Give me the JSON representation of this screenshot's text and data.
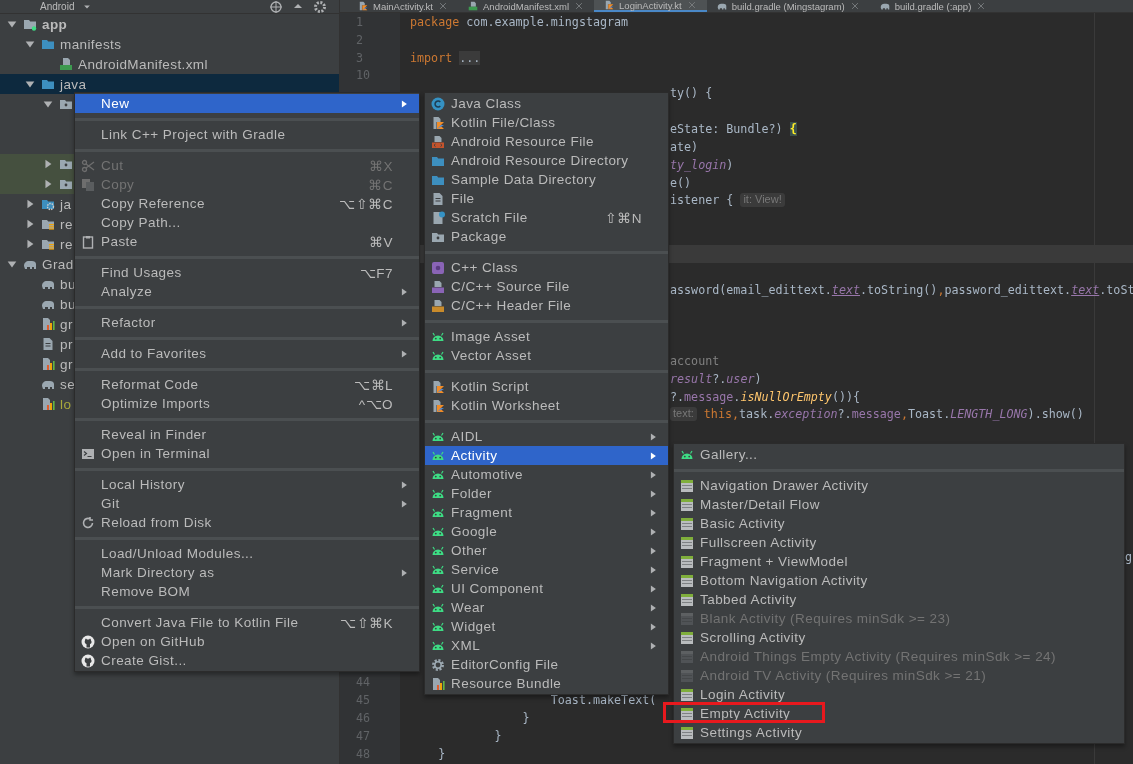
{
  "tabs": [
    {
      "label": "MainActivity.kt",
      "kind": "kotlin",
      "selected": false
    },
    {
      "label": "AndroidManifest.xml",
      "kind": "manifest",
      "selected": false
    },
    {
      "label": "LoginActivity.kt",
      "kind": "kotlin",
      "selected": true
    },
    {
      "label": "build.gradle (Mingstagram)",
      "kind": "gradle",
      "selected": false
    },
    {
      "label": "build.gradle (:app)",
      "kind": "gradle",
      "selected": false
    }
  ],
  "project": {
    "view": "Android",
    "tree": [
      {
        "label": "app",
        "kind": "module",
        "expanded": true,
        "selected": false,
        "children": [
          {
            "label": "manifests",
            "kind": "folder",
            "expanded": true,
            "selected": false,
            "children": [
              {
                "label": "AndroidManifest.xml",
                "kind": "manifest",
                "selected": false
              }
            ]
          },
          {
            "label": "java",
            "kind": "folder",
            "expanded": true,
            "selected": true,
            "children": [
              {
                "kind": "package",
                "expanded": true,
                "selected": false
              },
              {
                "kind": "test_package",
                "expanded": false,
                "selected": false
              },
              {
                "kind": "test_package",
                "expanded": false,
                "selected": false
              }
            ]
          },
          {
            "label": "ja",
            "kind": "generated",
            "expanded": false,
            "selected": false
          },
          {
            "label": "re",
            "kind": "res",
            "expanded": false,
            "selected": false
          },
          {
            "label": "re",
            "kind": "res",
            "expanded": false,
            "selected": false
          }
        ]
      },
      {
        "label": "Grad",
        "kind": "gradle_root",
        "expanded": true,
        "selected": false,
        "children": [
          {
            "label": "bu",
            "kind": "gradle",
            "selected": false
          },
          {
            "label": "bu",
            "kind": "gradle",
            "selected": false
          },
          {
            "label": "gr",
            "kind": "gradle_file",
            "selected": false
          },
          {
            "label": "pr",
            "kind": "properties",
            "selected": false
          },
          {
            "label": "gr",
            "kind": "gradle_file",
            "selected": false
          },
          {
            "label": "se",
            "kind": "gradle",
            "selected": false
          },
          {
            "label": "lo",
            "kind": "local_file",
            "selected": false
          }
        ]
      }
    ]
  },
  "editor": {
    "lines": [
      {
        "number": "1",
        "kind": "code",
        "current": false,
        "segments": [
          {
            "text": "package",
            "kind": "keyword"
          },
          {
            "text": " com.example.mingstagram",
            "kind": "plain"
          }
        ]
      },
      {
        "number": "2",
        "kind": "code",
        "current": false
      },
      {
        "number": "3",
        "kind": "code",
        "current": false,
        "segments": [
          {
            "text": "import",
            "kind": "keyword"
          },
          {
            "text": "...",
            "kind": "fold"
          }
        ]
      },
      {
        "number": "10",
        "kind": "code",
        "current": false
      },
      {
        "kind": "frag",
        "current": false,
        "segments": [
          {
            "text": "ty() {",
            "kind": "plain"
          }
        ]
      },
      {
        "kind": "blank",
        "current": false
      },
      {
        "kind": "frag",
        "current": false,
        "segments": [
          {
            "text": "eState: Bundle?) ",
            "kind": "plain"
          },
          {
            "text": "{",
            "kind": "brace"
          }
        ]
      },
      {
        "kind": "frag",
        "current": false,
        "segments": [
          {
            "text": "ate)",
            "kind": "plain"
          }
        ]
      },
      {
        "kind": "frag",
        "current": false,
        "segments": [
          {
            "text": "ty_login",
            "kind": "property"
          },
          {
            "text": ")",
            "kind": "plain"
          }
        ]
      },
      {
        "kind": "frag",
        "current": false,
        "segments": [
          {
            "text": "e()",
            "kind": "plain"
          }
        ]
      },
      {
        "kind": "frag",
        "current": false,
        "segments": [
          {
            "text": "istener { ",
            "kind": "plain"
          },
          {
            "text": "it: View!",
            "kind": "hint"
          }
        ]
      },
      {
        "kind": "blank",
        "current": false
      },
      {
        "kind": "blank",
        "current": false
      },
      {
        "kind": "blank",
        "current": true
      },
      {
        "kind": "blank",
        "current": false
      },
      {
        "kind": "frag",
        "current": false,
        "segments": [
          {
            "text": "assword(email_edittext.",
            "kind": "plain"
          },
          {
            "text": "text",
            "kind": "field"
          },
          {
            "text": ".toString()",
            "kind": "plain"
          },
          {
            "text": ",",
            "kind": "keyword"
          },
          {
            "text": "password_edittext.",
            "kind": "plain"
          },
          {
            "text": "text",
            "kind": "field"
          },
          {
            "text": ".toSt",
            "kind": "plain"
          }
        ]
      },
      {
        "kind": "blank",
        "current": false
      },
      {
        "kind": "blank",
        "current": false
      },
      {
        "kind": "blank",
        "current": false
      },
      {
        "kind": "frag",
        "current": false,
        "segments": [
          {
            "text": "account",
            "kind": "comment"
          }
        ]
      },
      {
        "kind": "frag",
        "current": false,
        "segments": [
          {
            "text": "result",
            "kind": "property"
          },
          {
            "text": "?.",
            "kind": "plain"
          },
          {
            "text": "user",
            "kind": "property"
          },
          {
            "text": ")",
            "kind": "plain"
          }
        ]
      },
      {
        "kind": "frag",
        "current": false,
        "segments": [
          {
            "text": "?.",
            "kind": "plain"
          },
          {
            "text": "message",
            "kind": "member"
          },
          {
            "text": ".",
            "kind": "plain"
          },
          {
            "text": "isNullOrEmpty",
            "kind": "function"
          },
          {
            "text": "()){",
            "kind": "plain"
          }
        ]
      },
      {
        "kind": "frag",
        "current": false,
        "segments": [
          {
            "text": "text:",
            "kind": "hint"
          },
          {
            "text": " this",
            "kind": "keyword"
          },
          {
            "text": ",",
            "kind": "keyword"
          },
          {
            "text": "task.",
            "kind": "plain"
          },
          {
            "text": "exception",
            "kind": "property"
          },
          {
            "text": "?.",
            "kind": "plain"
          },
          {
            "text": "message",
            "kind": "member"
          },
          {
            "text": ",",
            "kind": "keyword"
          },
          {
            "text": "Toast.",
            "kind": "plain"
          },
          {
            "text": "LENGTH_LONG",
            "kind": "property"
          },
          {
            "text": ").show()",
            "kind": "plain"
          }
        ]
      },
      {
        "kind": "blank",
        "current": false
      },
      {
        "kind": "blank",
        "current": false
      },
      {
        "kind": "blank",
        "current": false
      },
      {
        "kind": "blank",
        "current": false
      },
      {
        "kind": "blank",
        "current": false
      },
      {
        "kind": "blank",
        "current": false
      },
      {
        "kind": "blank",
        "current": false
      },
      {
        "kind": "edge",
        "current": false,
        "segments": [
          {
            "text": "g",
            "kind": "plain"
          }
        ]
      },
      {
        "kind": "blank",
        "current": false
      },
      {
        "kind": "blank",
        "current": false
      },
      {
        "kind": "blank",
        "current": false
      },
      {
        "kind": "blank",
        "current": false
      },
      {
        "kind": "blank",
        "current": false
      },
      {
        "kind": "blank",
        "current": false
      },
      {
        "number": "44",
        "kind": "code",
        "current": false
      },
      {
        "number": "45",
        "kind": "code",
        "current": false,
        "segments": [
          {
            "text": "                    Toast.makeText(",
            "kind": "plain"
          }
        ]
      },
      {
        "number": "46",
        "kind": "code",
        "current": false,
        "segments": [
          {
            "text": "                }",
            "kind": "plain"
          }
        ]
      },
      {
        "number": "47",
        "kind": "code",
        "current": false,
        "segments": [
          {
            "text": "            }",
            "kind": "plain"
          }
        ]
      },
      {
        "number": "48",
        "kind": "code",
        "current": false,
        "segments": [
          {
            "text": "    }",
            "kind": "plain"
          }
        ]
      }
    ]
  },
  "context_menu": {
    "groups": [
      [
        {
          "label": "New",
          "kind": "plain",
          "selected": true,
          "disabled": false,
          "submenu": true
        }
      ],
      [
        {
          "label": "Link C++ Project with Gradle",
          "kind": "plain",
          "selected": false,
          "disabled": false,
          "submenu": false
        }
      ],
      [
        {
          "label": "Cut",
          "kind": "cut",
          "shortcut": "⌘X",
          "selected": false,
          "disabled": true,
          "submenu": false
        },
        {
          "label": "Copy",
          "kind": "copy",
          "shortcut": "⌘C",
          "selected": false,
          "disabled": true,
          "submenu": false
        },
        {
          "label": "Copy Reference",
          "kind": "plain",
          "shortcut": "⌥⇧⌘C",
          "selected": false,
          "disabled": false,
          "submenu": false
        },
        {
          "label": "Copy Path...",
          "kind": "plain",
          "selected": false,
          "disabled": false,
          "submenu": false
        },
        {
          "label": "Paste",
          "kind": "paste",
          "shortcut": "⌘V",
          "selected": false,
          "disabled": false,
          "submenu": false
        }
      ],
      [
        {
          "label": "Find Usages",
          "kind": "plain",
          "shortcut": "⌥F7",
          "selected": false,
          "disabled": false,
          "submenu": false
        },
        {
          "label": "Analyze",
          "kind": "plain",
          "selected": false,
          "disabled": false,
          "submenu": true
        }
      ],
      [
        {
          "label": "Refactor",
          "kind": "plain",
          "selected": false,
          "disabled": false,
          "submenu": true
        }
      ],
      [
        {
          "label": "Add to Favorites",
          "kind": "plain",
          "selected": false,
          "disabled": false,
          "submenu": true
        }
      ],
      [
        {
          "label": "Reformat Code",
          "kind": "plain",
          "shortcut": "⌥⌘L",
          "selected": false,
          "disabled": false,
          "submenu": false
        },
        {
          "label": "Optimize Imports",
          "kind": "plain",
          "shortcut": "^⌥O",
          "selected": false,
          "disabled": false,
          "submenu": false
        }
      ],
      [
        {
          "label": "Reveal in Finder",
          "kind": "plain",
          "selected": false,
          "disabled": false,
          "submenu": false
        },
        {
          "label": "Open in Terminal",
          "kind": "terminal",
          "selected": false,
          "disabled": false,
          "submenu": false
        }
      ],
      [
        {
          "label": "Local History",
          "kind": "plain",
          "selected": false,
          "disabled": false,
          "submenu": true
        },
        {
          "label": "Git",
          "kind": "plain",
          "selected": false,
          "disabled": false,
          "submenu": true
        },
        {
          "label": "Reload from Disk",
          "kind": "refresh",
          "selected": false,
          "disabled": false,
          "submenu": false
        }
      ],
      [
        {
          "label": "Load/Unload Modules...",
          "kind": "plain",
          "selected": false,
          "disabled": false,
          "submenu": false
        },
        {
          "label": "Mark Directory as",
          "kind": "plain",
          "selected": false,
          "disabled": false,
          "submenu": true
        },
        {
          "label": "Remove BOM",
          "kind": "plain",
          "selected": false,
          "disabled": false,
          "submenu": false
        }
      ],
      [
        {
          "label": "Convert Java File to Kotlin File",
          "kind": "plain",
          "shortcut": "⌥⇧⌘K",
          "selected": false,
          "disabled": false,
          "submenu": false
        },
        {
          "label": "Open on GitHub",
          "kind": "github",
          "selected": false,
          "disabled": false,
          "submenu": false
        },
        {
          "label": "Create Gist...",
          "kind": "github",
          "selected": false,
          "disabled": false,
          "submenu": false
        }
      ]
    ]
  },
  "new_menu": {
    "groups": [
      [
        {
          "label": "Java Class",
          "kind": "java_class",
          "selected": false,
          "disabled": false,
          "submenu": false
        },
        {
          "label": "Kotlin File/Class",
          "kind": "kotlin_file",
          "selected": false,
          "disabled": false,
          "submenu": false
        },
        {
          "label": "Android Resource File",
          "kind": "resource_file",
          "selected": false,
          "disabled": false,
          "submenu": false
        },
        {
          "label": "Android Resource Directory",
          "kind": "folder",
          "selected": false,
          "disabled": false,
          "submenu": false
        },
        {
          "label": "Sample Data Directory",
          "kind": "folder",
          "selected": false,
          "disabled": false,
          "submenu": false
        },
        {
          "label": "File",
          "kind": "file",
          "selected": false,
          "disabled": false,
          "submenu": false
        },
        {
          "label": "Scratch File",
          "kind": "scratch",
          "shortcut": "⇧⌘N",
          "selected": false,
          "disabled": false,
          "submenu": false
        },
        {
          "label": "Package",
          "kind": "package",
          "selected": false,
          "disabled": false,
          "submenu": false
        }
      ],
      [
        {
          "label": "C++ Class",
          "kind": "cpp_class",
          "selected": false,
          "disabled": false,
          "submenu": false
        },
        {
          "label": "C/C++ Source File",
          "kind": "cpp_source",
          "selected": false,
          "disabled": false,
          "submenu": false
        },
        {
          "label": "C/C++ Header File",
          "kind": "cpp_header",
          "selected": false,
          "disabled": false,
          "submenu": false
        }
      ],
      [
        {
          "label": "Image Asset",
          "kind": "android",
          "selected": false,
          "disabled": false,
          "submenu": false
        },
        {
          "label": "Vector Asset",
          "kind": "android",
          "selected": false,
          "disabled": false,
          "submenu": false
        }
      ],
      [
        {
          "label": "Kotlin Script",
          "kind": "kotlin_file",
          "selected": false,
          "disabled": false,
          "submenu": false
        },
        {
          "label": "Kotlin Worksheet",
          "kind": "kotlin_file",
          "selected": false,
          "disabled": false,
          "submenu": false
        }
      ],
      [
        {
          "label": "AIDL",
          "kind": "android",
          "selected": false,
          "disabled": false,
          "submenu": true
        },
        {
          "label": "Activity",
          "kind": "android",
          "selected": true,
          "disabled": false,
          "submenu": true
        },
        {
          "label": "Automotive",
          "kind": "android",
          "selected": false,
          "disabled": false,
          "submenu": true
        },
        {
          "label": "Folder",
          "kind": "android",
          "selected": false,
          "disabled": false,
          "submenu": true
        },
        {
          "label": "Fragment",
          "kind": "android",
          "selected": false,
          "disabled": false,
          "submenu": true
        },
        {
          "label": "Google",
          "kind": "android",
          "selected": false,
          "disabled": false,
          "submenu": true
        },
        {
          "label": "Other",
          "kind": "android",
          "selected": false,
          "disabled": false,
          "submenu": true
        },
        {
          "label": "Service",
          "kind": "android",
          "selected": false,
          "disabled": false,
          "submenu": true
        },
        {
          "label": "UI Component",
          "kind": "android",
          "selected": false,
          "disabled": false,
          "submenu": true
        },
        {
          "label": "Wear",
          "kind": "android",
          "selected": false,
          "disabled": false,
          "submenu": true
        },
        {
          "label": "Widget",
          "kind": "android",
          "selected": false,
          "disabled": false,
          "submenu": true
        },
        {
          "label": "XML",
          "kind": "android",
          "selected": false,
          "disabled": false,
          "submenu": true
        },
        {
          "label": "EditorConfig File",
          "kind": "gear",
          "selected": false,
          "disabled": false,
          "submenu": false
        },
        {
          "label": "Resource Bundle",
          "kind": "bundle",
          "selected": false,
          "disabled": false,
          "submenu": false
        }
      ]
    ]
  },
  "activity_menu": {
    "groups": [
      [
        {
          "label": "Gallery...",
          "kind": "android",
          "selected": false,
          "disabled": false,
          "marked": false
        }
      ],
      [
        {
          "label": "Navigation Drawer Activity",
          "kind": "template",
          "selected": false,
          "disabled": false,
          "marked": false
        },
        {
          "label": "Master/Detail Flow",
          "kind": "template",
          "selected": false,
          "disabled": false,
          "marked": false
        },
        {
          "label": "Basic Activity",
          "kind": "template",
          "selected": false,
          "disabled": false,
          "marked": false
        },
        {
          "label": "Fullscreen Activity",
          "kind": "template",
          "selected": false,
          "disabled": false,
          "marked": false
        },
        {
          "label": "Fragment + ViewModel",
          "kind": "template",
          "selected": false,
          "disabled": false,
          "marked": false
        },
        {
          "label": "Bottom Navigation Activity",
          "kind": "template",
          "selected": false,
          "disabled": false,
          "marked": false
        },
        {
          "label": "Tabbed Activity",
          "kind": "template",
          "selected": false,
          "disabled": false,
          "marked": false
        },
        {
          "label": "Blank Activity (Requires minSdk >= 23)",
          "kind": "template",
          "selected": false,
          "disabled": true,
          "marked": false
        },
        {
          "label": "Scrolling Activity",
          "kind": "template",
          "selected": false,
          "disabled": false,
          "marked": false
        },
        {
          "label": "Android Things Empty Activity (Requires minSdk >= 24)",
          "kind": "template",
          "selected": false,
          "disabled": true,
          "marked": false
        },
        {
          "label": "Android TV Activity (Requires minSdk >= 21)",
          "kind": "template",
          "selected": false,
          "disabled": true,
          "marked": false
        },
        {
          "label": "Login Activity",
          "kind": "template",
          "selected": false,
          "disabled": false,
          "marked": false
        },
        {
          "label": "Empty Activity",
          "kind": "template",
          "selected": false,
          "disabled": false,
          "marked": true
        },
        {
          "label": "Settings Activity",
          "kind": "template",
          "selected": false,
          "disabled": false,
          "marked": false
        }
      ]
    ]
  }
}
